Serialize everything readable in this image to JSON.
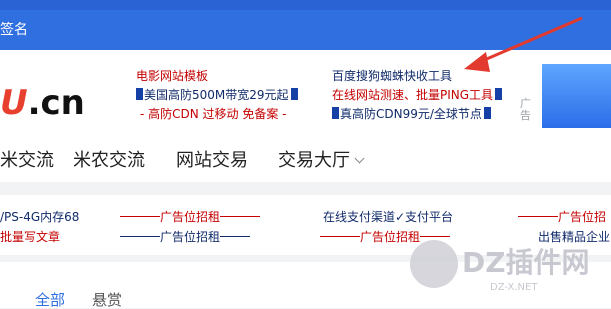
{
  "tab_bar": {
    "partial_tab": "签名"
  },
  "logo": {
    "mark": "U",
    "text": ".cn"
  },
  "header_ads": [
    {
      "text": "电影网站模板",
      "color": "#c40000"
    },
    {
      "text": "美国高防500M带宽29元起",
      "color": "#102a6a"
    },
    {
      "text": "- 高防CDN 过移动 免备案 -",
      "color": "#c40000"
    },
    {
      "text": "百度搜狗蜘蛛快收工具",
      "color": "#102a6a"
    },
    {
      "text": "在线网站测速、批量PING工具",
      "color": "#c40000"
    },
    {
      "text": "真高防CDN99元/全球节点",
      "color": "#102a6a"
    }
  ],
  "ad_tag": "广告",
  "nav": {
    "items": [
      "米交流",
      "米农交流",
      "网站交易",
      "交易大厅"
    ],
    "dropdown_icon": "chevron-down-icon"
  },
  "ad_links": {
    "row1": [
      "/PS-4G内存68",
      "广告位招租",
      "在线支付渠道✓支付平台",
      "广告位招"
    ],
    "row2": [
      "批量写文章",
      "广告位招租",
      "广告位招租",
      "出售精品企业"
    ]
  },
  "content_tabs": [
    "全部",
    "悬赏"
  ],
  "watermark": {
    "text": "DZ插件网",
    "sub": "DZ-X.NET"
  },
  "colors": {
    "brand_blue": "#2f6fe0",
    "ad_red": "#c40000",
    "ad_navy": "#102a6a",
    "logo_red": "#e8402f"
  }
}
